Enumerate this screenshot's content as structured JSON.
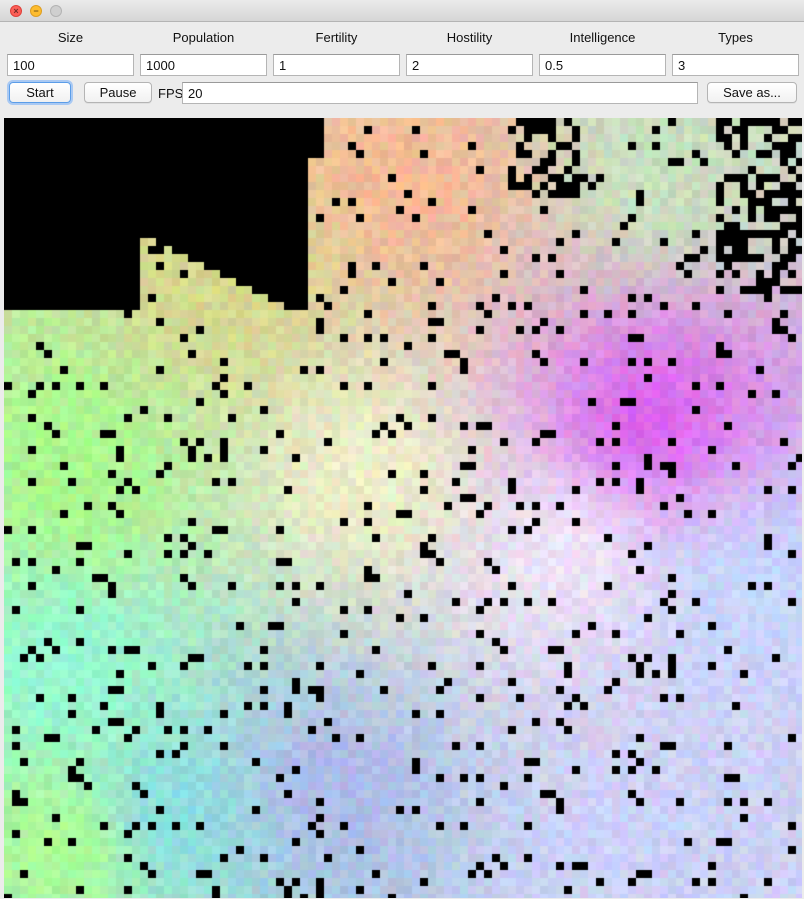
{
  "window": {
    "close_glyph": "×",
    "minimize_glyph": "−"
  },
  "params": {
    "size": {
      "label": "Size",
      "value": "100"
    },
    "population": {
      "label": "Population",
      "value": "1000"
    },
    "fertility": {
      "label": "Fertility",
      "value": "1"
    },
    "hostility": {
      "label": "Hostility",
      "value": "2"
    },
    "intelligence": {
      "label": "Intelligence",
      "value": "0.5"
    },
    "types": {
      "label": "Types",
      "value": "3"
    }
  },
  "controls": {
    "start_label": "Start",
    "pause_label": "Pause",
    "fps_label": "FPS",
    "fps_value": "20",
    "save_label": "Save as..."
  },
  "colors": {
    "background": "#000000",
    "focus_ring": "#5b9de8",
    "close": "#fc5f57",
    "minimize": "#fdbc2e",
    "zoom": "#cfcfcf"
  }
}
